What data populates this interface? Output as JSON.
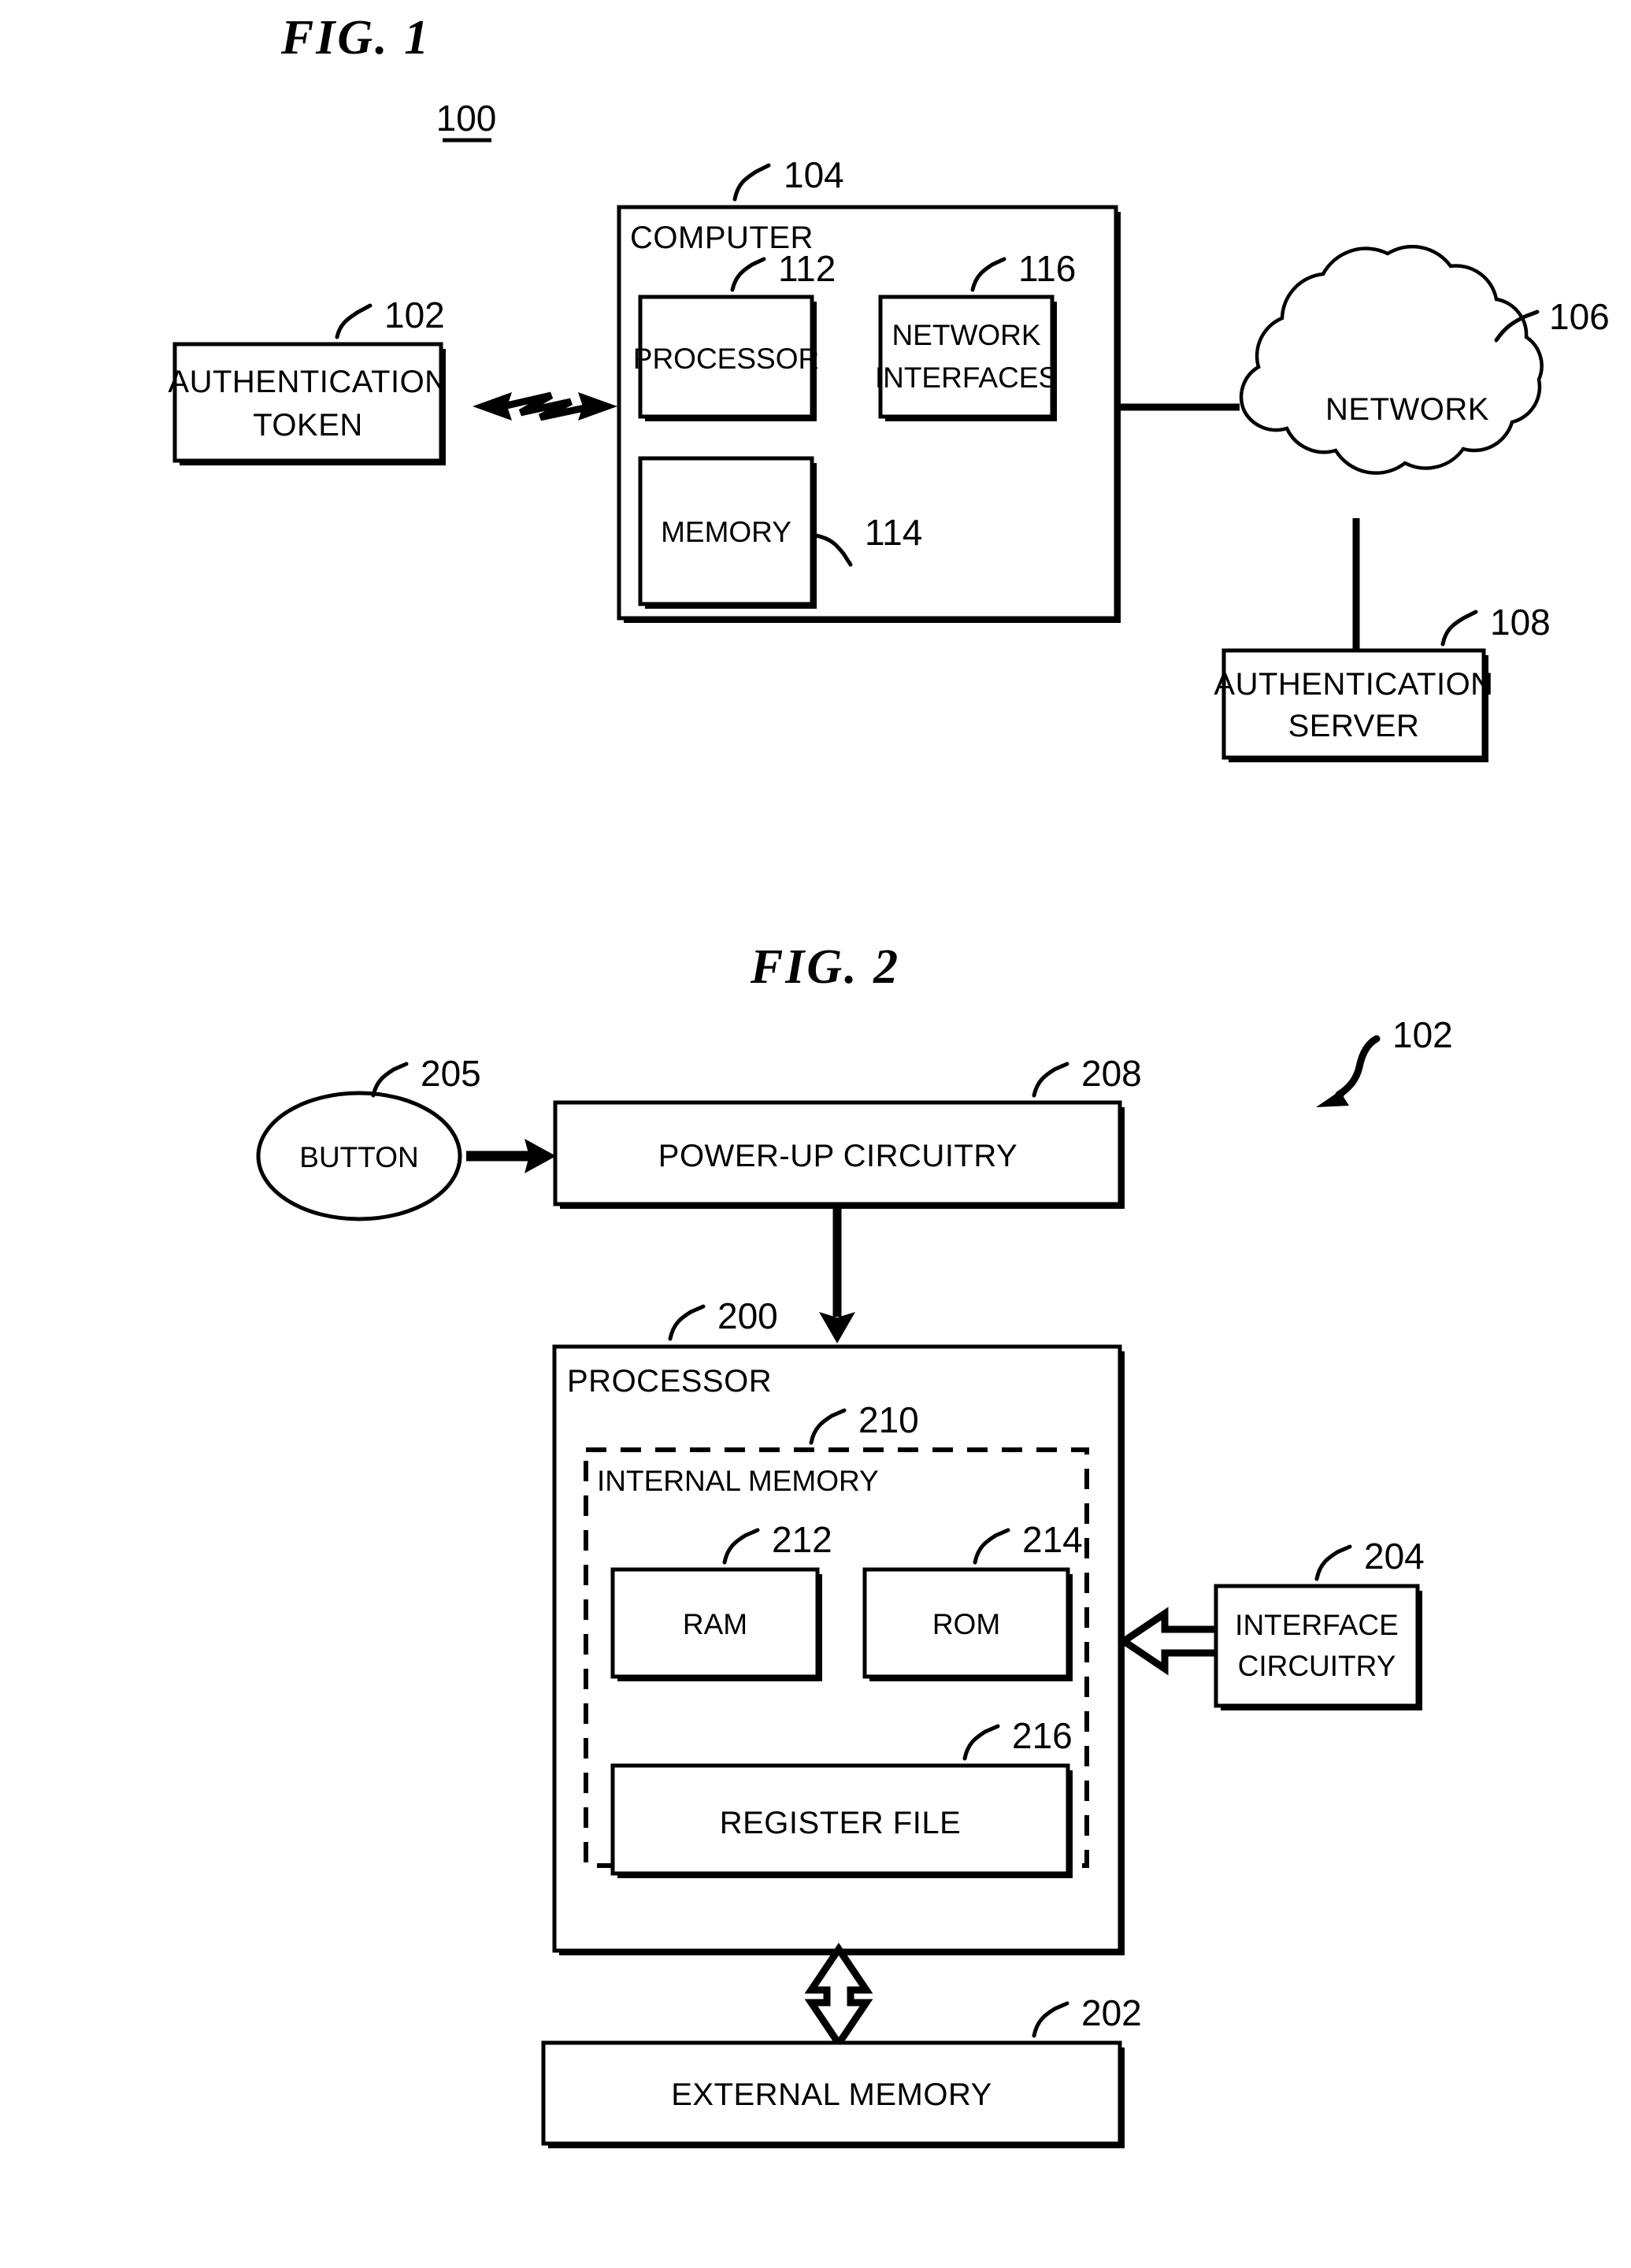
{
  "figures": [
    {
      "id": "fig1",
      "title": "FIG.  1",
      "system_ref": "100",
      "nodes": {
        "auth_token": {
          "label_line1": "AUTHENTICATION",
          "label_line2": "TOKEN",
          "ref": "102"
        },
        "computer": {
          "label": "COMPUTER",
          "ref": "104"
        },
        "processor": {
          "label": "PROCESSOR",
          "ref": "112"
        },
        "memory": {
          "label": "MEMORY",
          "ref": "114"
        },
        "network_interfaces": {
          "label_line1": "NETWORK",
          "label_line2": "INTERFACES",
          "ref": "116"
        },
        "network": {
          "label": "NETWORK",
          "ref": "106"
        },
        "auth_server": {
          "label_line1": "AUTHENTICATION",
          "label_line2": "SERVER",
          "ref": "108"
        }
      }
    },
    {
      "id": "fig2",
      "title": "FIG.  2",
      "system_ref": "102",
      "nodes": {
        "button": {
          "label": "BUTTON",
          "ref": "205"
        },
        "power_up_circuitry": {
          "label": "POWER-UP CIRCUITRY",
          "ref": "208"
        },
        "processor": {
          "label": "PROCESSOR",
          "ref": "200"
        },
        "internal_memory": {
          "label": "INTERNAL MEMORY",
          "ref": "210"
        },
        "ram": {
          "label": "RAM",
          "ref": "212"
        },
        "rom": {
          "label": "ROM",
          "ref": "214"
        },
        "register_file": {
          "label": "REGISTER FILE",
          "ref": "216"
        },
        "interface_circuitry": {
          "label_line1": "INTERFACE",
          "label_line2": "CIRCUITRY",
          "ref": "204"
        },
        "external_memory": {
          "label": "EXTERNAL MEMORY",
          "ref": "202"
        }
      }
    }
  ],
  "style": {
    "line_color": "#000000",
    "page_color": "#ffffff"
  }
}
